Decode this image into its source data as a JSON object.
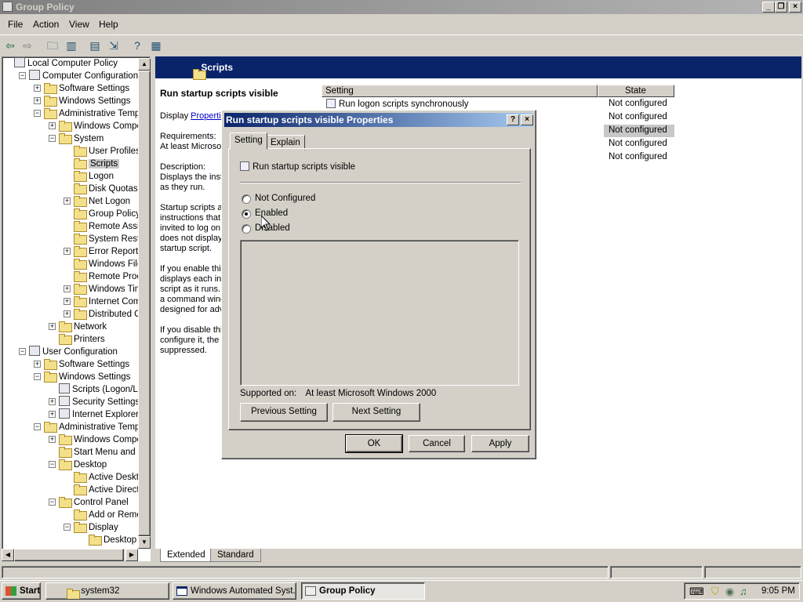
{
  "window": {
    "title": "Group Policy"
  },
  "menu": [
    "File",
    "Action",
    "View",
    "Help"
  ],
  "tree": [
    {
      "label": "Local Computer Policy",
      "indent": 0,
      "exp": "",
      "icon": "policy-icon"
    },
    {
      "label": "Computer Configuration",
      "indent": 1,
      "exp": "-",
      "icon": "computer-icon"
    },
    {
      "label": "Software Settings",
      "indent": 2,
      "exp": "+",
      "icon": "folder"
    },
    {
      "label": "Windows Settings",
      "indent": 2,
      "exp": "+",
      "icon": "folder"
    },
    {
      "label": "Administrative Template",
      "indent": 2,
      "exp": "-",
      "icon": "folder"
    },
    {
      "label": "Windows Compone",
      "indent": 3,
      "exp": "+",
      "icon": "folder"
    },
    {
      "label": "System",
      "indent": 3,
      "exp": "-",
      "icon": "folder"
    },
    {
      "label": "User Profiles",
      "indent": 4,
      "exp": "",
      "icon": "folder"
    },
    {
      "label": "Scripts",
      "indent": 4,
      "exp": "",
      "icon": "folder",
      "selected": true
    },
    {
      "label": "Logon",
      "indent": 4,
      "exp": "",
      "icon": "folder"
    },
    {
      "label": "Disk Quotas",
      "indent": 4,
      "exp": "",
      "icon": "folder"
    },
    {
      "label": "Net Logon",
      "indent": 4,
      "exp": "+",
      "icon": "folder"
    },
    {
      "label": "Group Policy",
      "indent": 4,
      "exp": "",
      "icon": "folder"
    },
    {
      "label": "Remote Assista",
      "indent": 4,
      "exp": "",
      "icon": "folder"
    },
    {
      "label": "System Restore",
      "indent": 4,
      "exp": "",
      "icon": "folder"
    },
    {
      "label": "Error Reporting",
      "indent": 4,
      "exp": "+",
      "icon": "folder"
    },
    {
      "label": "Windows File P",
      "indent": 4,
      "exp": "",
      "icon": "folder"
    },
    {
      "label": "Remote Proced",
      "indent": 4,
      "exp": "",
      "icon": "folder"
    },
    {
      "label": "Windows Time",
      "indent": 4,
      "exp": "+",
      "icon": "folder"
    },
    {
      "label": "Internet Commu",
      "indent": 4,
      "exp": "+",
      "icon": "folder"
    },
    {
      "label": "Distributed COM",
      "indent": 4,
      "exp": "+",
      "icon": "folder"
    },
    {
      "label": "Network",
      "indent": 3,
      "exp": "+",
      "icon": "folder"
    },
    {
      "label": "Printers",
      "indent": 3,
      "exp": "",
      "icon": "folder"
    },
    {
      "label": "User Configuration",
      "indent": 1,
      "exp": "-",
      "icon": "user-icon"
    },
    {
      "label": "Software Settings",
      "indent": 2,
      "exp": "+",
      "icon": "folder"
    },
    {
      "label": "Windows Settings",
      "indent": 2,
      "exp": "-",
      "icon": "folder"
    },
    {
      "label": "Scripts (Logon/Log",
      "indent": 3,
      "exp": "",
      "icon": "script-icon"
    },
    {
      "label": "Security Settings",
      "indent": 3,
      "exp": "+",
      "icon": "security-icon"
    },
    {
      "label": "Internet Explorer Ma",
      "indent": 3,
      "exp": "+",
      "icon": "ie-icon"
    },
    {
      "label": "Administrative Template",
      "indent": 2,
      "exp": "-",
      "icon": "folder"
    },
    {
      "label": "Windows Compone",
      "indent": 3,
      "exp": "+",
      "icon": "folder"
    },
    {
      "label": "Start Menu and Tas",
      "indent": 3,
      "exp": "",
      "icon": "folder"
    },
    {
      "label": "Desktop",
      "indent": 3,
      "exp": "-",
      "icon": "folder"
    },
    {
      "label": "Active Desktop",
      "indent": 4,
      "exp": "",
      "icon": "folder"
    },
    {
      "label": "Active Directory",
      "indent": 4,
      "exp": "",
      "icon": "folder"
    },
    {
      "label": "Control Panel",
      "indent": 3,
      "exp": "-",
      "icon": "folder"
    },
    {
      "label": "Add or Remove",
      "indent": 4,
      "exp": "",
      "icon": "folder"
    },
    {
      "label": "Display",
      "indent": 4,
      "exp": "-",
      "icon": "folder"
    },
    {
      "label": "Desktop Th",
      "indent": 5,
      "exp": "",
      "icon": "folder"
    }
  ],
  "right": {
    "header": "Scripts",
    "setting_title": "Run startup scripts visible",
    "display_prefix": "Display ",
    "display_link": "Properties",
    "lines": [
      "Requirements:",
      "At least Microsof",
      "",
      "Description:",
      "Displays the instr",
      "as they run.",
      "",
      "Startup scripts ar",
      "instructions that",
      "invited to log on.",
      "does not display",
      "startup script.",
      "",
      "If you enable this",
      "displays each ins",
      "script as it runs.",
      "a command wind",
      "designed for adv",
      "",
      "If you disable this",
      "configure it, the",
      "suppressed."
    ],
    "columns": {
      "setting": "Setting",
      "state": "State"
    },
    "first_row_setting": "Run logon scripts synchronously",
    "states": [
      "Not configured",
      "Not configured",
      "Not configured",
      "Not configured",
      "Not configured"
    ],
    "tabs": [
      "Extended",
      "Standard"
    ]
  },
  "dialog": {
    "title": "Run startup scripts visible Properties",
    "help_label": "?",
    "close_label": "×",
    "tabs": [
      "Setting",
      "Explain"
    ],
    "setting_name": "Run startup scripts visible",
    "options": [
      "Not Configured",
      "Enabled",
      "Disabled"
    ],
    "selected_option": "Enabled",
    "supported_label": "Supported on:",
    "supported_value": "At least Microsoft Windows 2000",
    "prev_label": "Previous Setting",
    "next_label": "Next Setting",
    "ok_label": "OK",
    "cancel_label": "Cancel",
    "apply_label": "Apply"
  },
  "taskbar": {
    "start_label": "Start",
    "tasks": [
      "system32",
      "Windows Automated Syst...",
      "Group Policy"
    ],
    "active_task": "Group Policy",
    "clock": "9:05 PM"
  }
}
